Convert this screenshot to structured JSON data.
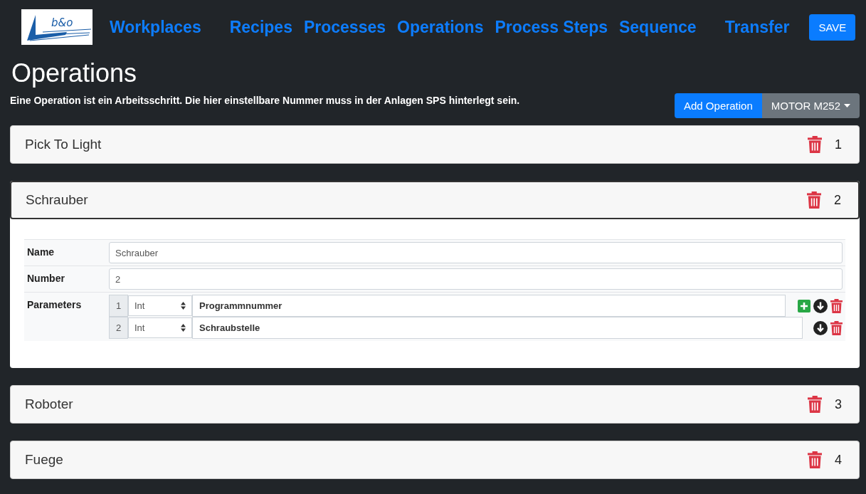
{
  "nav": {
    "logo_text": "b&o",
    "links": [
      "Workplaces",
      "Recipes",
      "Processes",
      "Operations",
      "Process Steps",
      "Sequence",
      "Transfer"
    ],
    "save": "SAVE"
  },
  "page": {
    "title": "Operations",
    "description": "Eine Operation ist ein Arbeitsschritt. Die hier einstellbare Nummer muss in der Anlagen SPS hinterlegt sein.",
    "add_button": "Add Operation",
    "machine_dropdown": "MOTOR M252"
  },
  "operations": [
    {
      "name": "Pick To Light",
      "number": "1",
      "expanded": false
    },
    {
      "name": "Schrauber",
      "number": "2",
      "expanded": true,
      "details": {
        "name_label": "Name",
        "name_value": "Schrauber",
        "number_label": "Number",
        "number_value": "2",
        "parameters_label": "Parameters",
        "parameters": [
          {
            "index": "1",
            "type": "Int",
            "name": "Programmnummer",
            "addable": true
          },
          {
            "index": "2",
            "type": "Int",
            "name": "Schraubstelle",
            "addable": false
          }
        ]
      }
    },
    {
      "name": "Roboter",
      "number": "3",
      "expanded": false
    },
    {
      "name": "Fuege",
      "number": "4",
      "expanded": false
    }
  ]
}
